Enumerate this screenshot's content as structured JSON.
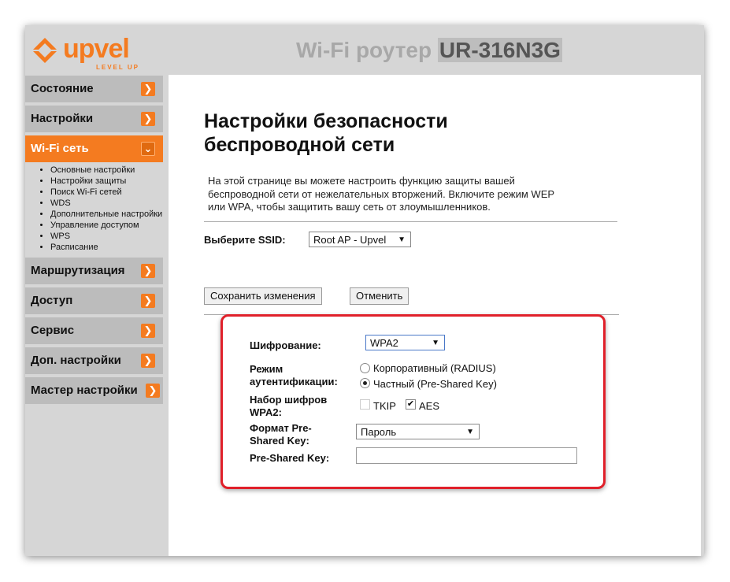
{
  "header": {
    "logo_text": "upvel",
    "logo_tagline": "LEVEL UP",
    "router_title": "Wi-Fi роутер",
    "router_model": "UR-316N3G"
  },
  "sidebar": {
    "items": [
      {
        "label": "Состояние"
      },
      {
        "label": "Настройки"
      },
      {
        "label": "Wi-Fi сеть",
        "expanded": true,
        "subitems": [
          "Основные настройки",
          "Настройки защиты",
          "Поиск Wi-Fi сетей",
          "WDS",
          "Дополнительные настройки",
          "Управление доступом",
          "WPS",
          "Расписание"
        ]
      },
      {
        "label": "Маршрутизация"
      },
      {
        "label": "Доступ"
      },
      {
        "label": "Сервис"
      },
      {
        "label": "Доп. настройки"
      },
      {
        "label": "Мастер настройки"
      }
    ]
  },
  "main": {
    "title_line1": "Настройки безопасности",
    "title_line2": "беспроводной сети",
    "intro_line1": "На этой странице вы можете настроить функцию защиты вашей",
    "intro_line2": "беспроводной сети от нежелательных вторжений. Включите режим WEP",
    "intro_line3": "или WPA, чтобы защитить вашу сеть от злоумышленников.",
    "ssid_label": "Выберите SSID:",
    "ssid_value": "Root AP - Upvel",
    "save_label": "Сохранить изменения",
    "cancel_label": "Отменить"
  },
  "security": {
    "encryption_label": "Шифрование:",
    "encryption_value": "WPA2",
    "auth_label_line1": "Режим",
    "auth_label_line2": "аутентификации:",
    "auth_option_enterprise": "Корпоративный (RADIUS)",
    "auth_option_personal": "Частный (Pre-Shared Key)",
    "auth_selected": "personal",
    "cipher_label_line1": "Набор шифров",
    "cipher_label_line2": "WPA2:",
    "cipher_tkip": "TKIP",
    "cipher_aes": "AES",
    "tkip_checked": false,
    "aes_checked": true,
    "psk_format_label_line1": "Формат Pre-",
    "psk_format_label_line2": "Shared Key:",
    "psk_format_value": "Пароль",
    "psk_label": "Pre-Shared Key:",
    "psk_value": ""
  },
  "colors": {
    "accent": "#f47b20",
    "highlight_border": "#e0202a"
  }
}
